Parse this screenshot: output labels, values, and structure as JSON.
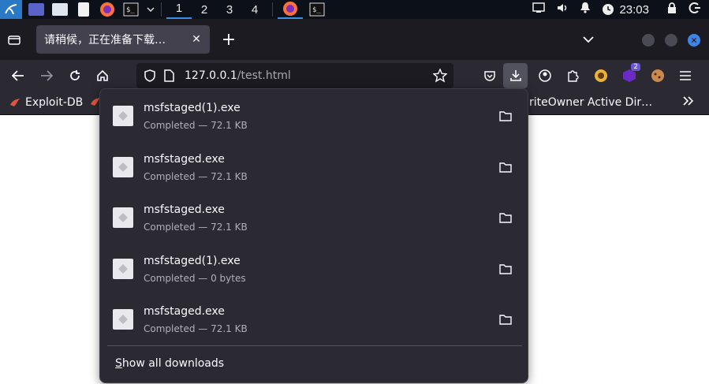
{
  "taskbar": {
    "workspaces": [
      "1",
      "2",
      "3",
      "4"
    ],
    "clock": "23:03"
  },
  "browser": {
    "tab_title": "请稍候，正在准备下载…",
    "url_host": "127.0.0.1",
    "url_path": "/test.html",
    "extension_badge": "2"
  },
  "bookmarks": {
    "items": [
      "Exploit-DB"
    ],
    "right_item": "riteOwner Active Dir…"
  },
  "downloads": {
    "items": [
      {
        "name": "msfstaged(1).exe",
        "status": "Completed — 72.1 KB"
      },
      {
        "name": "msfstaged.exe",
        "status": "Completed — 72.1 KB"
      },
      {
        "name": "msfstaged.exe",
        "status": "Completed — 72.1 KB"
      },
      {
        "name": "msfstaged(1).exe",
        "status": "Completed — 0 bytes"
      },
      {
        "name": "msfstaged.exe",
        "status": "Completed — 72.1 KB"
      }
    ],
    "show_all_first": "S",
    "show_all_rest": "how all downloads"
  },
  "colors": {
    "accent": "#3d8fe6",
    "panel_bg": "#2b2a33",
    "toolbar_bg": "#2b2a33",
    "tabstrip_bg": "#1c1b22",
    "taskbar_bg": "#0c1018"
  },
  "icons": {
    "downloads": "folder-icon",
    "file": "file-icon"
  }
}
